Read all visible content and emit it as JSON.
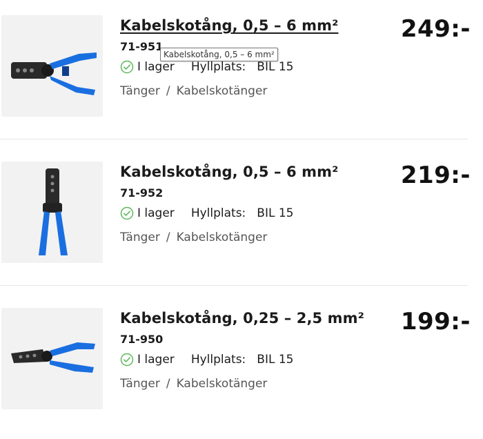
{
  "products": [
    {
      "title": "Kabelskotång, 0,5 – 6 mm²",
      "article_number": "71-951",
      "stock_status": "I lager",
      "shelf_label": "Hyllplats:",
      "shelf_value": "BIL 15",
      "breadcrumb": [
        "Tänger",
        "Kabelskotänger"
      ],
      "price": "249:-"
    },
    {
      "title": "Kabelskotång, 0,5 – 6 mm²",
      "article_number": "71-952",
      "stock_status": "I lager",
      "shelf_label": "Hyllplats:",
      "shelf_value": "BIL 15",
      "breadcrumb": [
        "Tänger",
        "Kabelskotänger"
      ],
      "price": "219:-"
    },
    {
      "title": "Kabelskotång, 0,25 – 2,5 mm²",
      "article_number": "71-950",
      "stock_status": "I lager",
      "shelf_label": "Hyllplats:",
      "shelf_value": "BIL 15",
      "breadcrumb": [
        "Tänger",
        "Kabelskotänger"
      ],
      "price": "199:-"
    }
  ],
  "breadcrumb_separator": "/",
  "tooltip": "Kabelskotång, 0,5 – 6 mm²",
  "colors": {
    "stock_green": "#5cb85c",
    "tool_blue": "#1a6fe0",
    "price_text": "#111111"
  }
}
